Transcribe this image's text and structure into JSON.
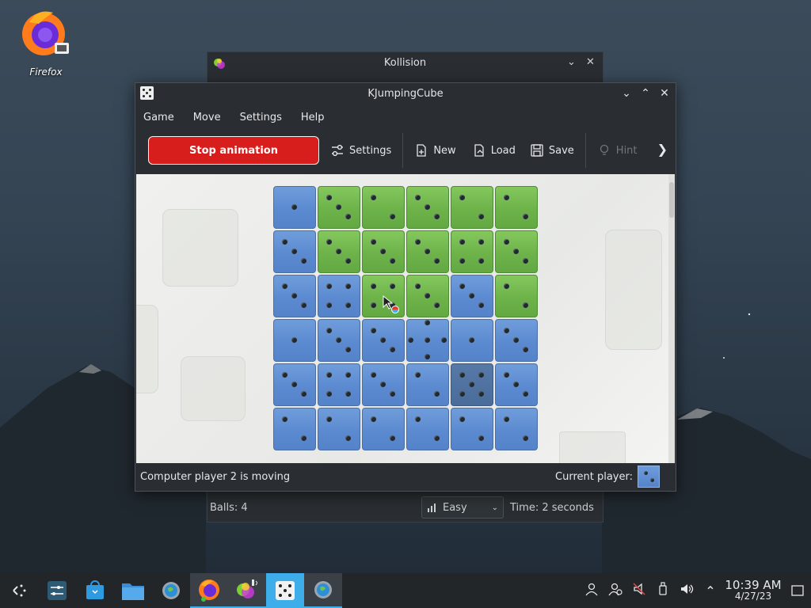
{
  "desktop": {
    "firefox_label": "Firefox"
  },
  "kollision": {
    "title": "Kollision",
    "balls": "Balls: 4",
    "difficulty": "Easy",
    "time": "Time: 2 seconds"
  },
  "window": {
    "title": "KJumpingCube",
    "menu": [
      "Game",
      "Move",
      "Settings",
      "Help"
    ],
    "toolbar": {
      "stop_label": "Stop animation",
      "settings_label": "Settings",
      "new_label": "New",
      "load_label": "Load",
      "save_label": "Save",
      "hint_label": "Hint"
    },
    "status_message": "Computer player 2 is moving",
    "current_player_label": "Current player:"
  },
  "board": {
    "cells": [
      [
        {
          "c": "blue",
          "n": 1
        },
        {
          "c": "green",
          "n": 3
        },
        {
          "c": "green",
          "n": 2
        },
        {
          "c": "green",
          "n": 3
        },
        {
          "c": "green",
          "n": 2
        },
        {
          "c": "green",
          "n": 2
        }
      ],
      [
        {
          "c": "blue",
          "n": 3
        },
        {
          "c": "green",
          "n": 3
        },
        {
          "c": "green",
          "n": 3
        },
        {
          "c": "green",
          "n": 3
        },
        {
          "c": "green",
          "n": 4
        },
        {
          "c": "green",
          "n": 3
        }
      ],
      [
        {
          "c": "blue",
          "n": 3
        },
        {
          "c": "blue",
          "n": 4
        },
        {
          "c": "green",
          "n": 4
        },
        {
          "c": "green",
          "n": 3
        },
        {
          "c": "blue",
          "n": 3
        },
        {
          "c": "green",
          "n": 2
        }
      ],
      [
        {
          "c": "blue",
          "n": 1
        },
        {
          "c": "blue",
          "n": 3
        },
        {
          "c": "blue",
          "n": 3
        },
        {
          "c": "blue",
          "n": 5
        },
        {
          "c": "blue",
          "n": 1
        },
        {
          "c": "blue",
          "n": 3
        }
      ],
      [
        {
          "c": "blue",
          "n": 3
        },
        {
          "c": "blue",
          "n": 4
        },
        {
          "c": "blue",
          "n": 3
        },
        {
          "c": "blue",
          "n": 2
        },
        {
          "c": "dark",
          "n": 5
        },
        {
          "c": "blue",
          "n": 3
        }
      ],
      [
        {
          "c": "blue",
          "n": 2
        },
        {
          "c": "blue",
          "n": 2
        },
        {
          "c": "blue",
          "n": 2
        },
        {
          "c": "blue",
          "n": 2
        },
        {
          "c": "blue",
          "n": 2
        },
        {
          "c": "blue",
          "n": 2
        }
      ]
    ],
    "current_player_color": "#5c8ad0"
  },
  "taskbar": {
    "items": [
      "app-launcher-icon",
      "system-settings-icon",
      "discover-store-icon",
      "dolphin-files-icon",
      "globe-settings-icon",
      "firefox-icon",
      "kollision-icon",
      "kjumpingcube-icon",
      "globe-settings-icon"
    ],
    "time": "10:39 AM",
    "date": "4/27/23"
  },
  "colors": {
    "accent": "#3daee9",
    "stop_button": "#d81d1d",
    "blue_cube": "#5c8ad0",
    "green_cube": "#6db34a"
  }
}
